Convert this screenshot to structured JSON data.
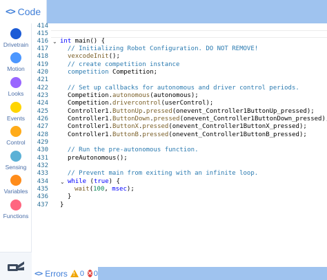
{
  "code_tab": {
    "icon": "code-brackets-icon",
    "label": "Code",
    "color": "#3f7ed8"
  },
  "categories": [
    {
      "name": "Drivetrain",
      "color": "#1c5bd6"
    },
    {
      "name": "Motion",
      "color": "#4c97ff"
    },
    {
      "name": "Looks",
      "color": "#9966ff"
    },
    {
      "name": "Events",
      "color": "#ffd500"
    },
    {
      "name": "Control",
      "color": "#ffab19"
    },
    {
      "name": "Sensing",
      "color": "#5cb1d6"
    },
    {
      "name": "Variables",
      "color": "#ff8c1a"
    },
    {
      "name": "Functions",
      "color": "#ff6680"
    }
  ],
  "line_numbers": [
    "414",
    "415",
    "416",
    "417",
    "418",
    "419",
    "420",
    "421",
    "422",
    "423",
    "424",
    "425",
    "426",
    "427",
    "428",
    "429",
    "430",
    "431",
    "432",
    "433",
    "434",
    "435",
    "436",
    "437"
  ],
  "code": {
    "l416_kw": "int",
    "l416_rest": " main() {",
    "l417": "  // Initializing Robot Configuration. DO NOT REMOVE!",
    "l418_fn": "vexcodeInit",
    "l418_rest": "();",
    "l419": "  // create competition instance",
    "l420_type": "competition",
    "l420_rest": " Competition;",
    "l422": "  // Set up callbacks for autonomous and driver control periods.",
    "l423_a": "Competition.",
    "l423_fn": "autonomous",
    "l423_b": "(autonomous);",
    "l424_a": "Competition.",
    "l424_fn": "drivercontrol",
    "l424_b": "(userControl);",
    "l425_a": "Controller1.",
    "l425_fn1": "ButtonUp",
    "l425_b": ".",
    "l425_fn2": "pressed",
    "l425_c": "(onevent_Controller1ButtonUp_pressed);",
    "l426_a": "Controller1.",
    "l426_fn1": "ButtonDown",
    "l426_b": ".",
    "l426_fn2": "pressed",
    "l426_c": "(onevent_Controller1ButtonDown_pressed);",
    "l427_a": "Controller1.",
    "l427_fn1": "ButtonX",
    "l427_b": ".",
    "l427_fn2": "pressed",
    "l427_c": "(onevent_Controller1ButtonX_pressed);",
    "l428_a": "Controller1.",
    "l428_fn1": "ButtonB",
    "l428_b": ".",
    "l428_fn2": "pressed",
    "l428_c": "(onevent_Controller1ButtonB_pressed);",
    "l430": "  // Run the pre-autonomous function.",
    "l431": "preAutonomous();",
    "l433": "  // Prevent main from exiting with an infinite loop.",
    "l434_kw": "while",
    "l434_a": " (",
    "l434_kw2": "true",
    "l434_b": ") {",
    "l435_fn": "wait",
    "l435_a": "(",
    "l435_num": "100",
    "l435_b": ", ",
    "l435_kw": "msec",
    "l435_c": ");",
    "l436": "}",
    "l437": "}"
  },
  "devices_icon": "devices-icon",
  "status": {
    "icon": "code-brackets-icon",
    "label": "Errors",
    "warnings": "0",
    "errors": "0"
  }
}
